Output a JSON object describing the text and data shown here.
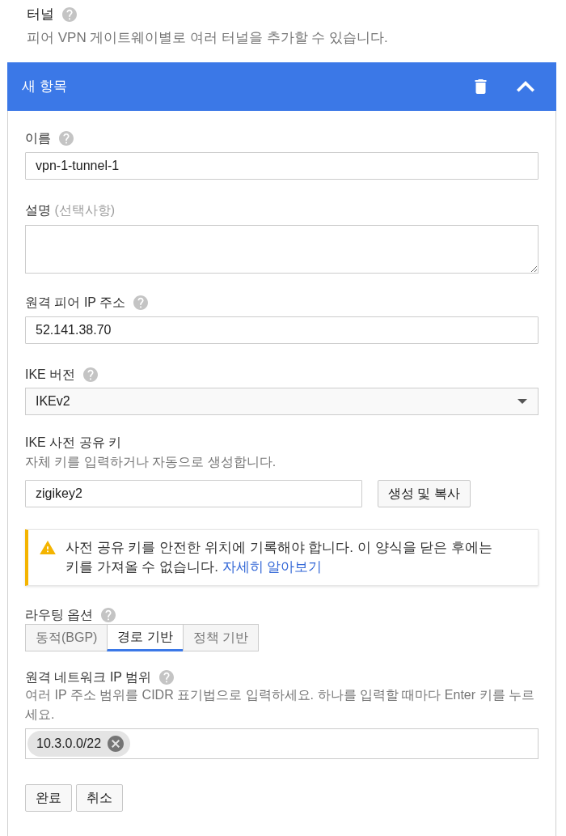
{
  "section": {
    "title": "터널",
    "help": true,
    "description": "피어 VPN 게이트웨이별로 여러 터널을 추가할 수 있습니다."
  },
  "panel": {
    "title": "새 항목",
    "expanded": true
  },
  "fields": [
    {
      "kind": "text",
      "label": "이름",
      "help": true,
      "value": "vpn-1-tunnel-1"
    },
    {
      "kind": "textarea",
      "label": "설명",
      "note": "(선택사항)",
      "help": false
    },
    {
      "kind": "text",
      "label": "원격 피어 IP 주소",
      "help": true,
      "value": "52.141.38.70"
    },
    {
      "kind": "select",
      "label": "IKE 버전",
      "help": true,
      "value": "IKEv2"
    },
    {
      "kind": "key",
      "label": "IKE 사전 공유 키",
      "help": false,
      "hint": "자체 키를 입력하거나 자동으로 생성합니다.",
      "value": "zigikey2",
      "button": "생성 및 복사"
    },
    {
      "kind": "warning",
      "text": "사전 공유 키를 안전한 위치에 기록해야 합니다. 이 양식을 닫은 후에는 키를 가져올 수 없습니다.",
      "link": "자세히 알아보기"
    },
    {
      "kind": "tabs",
      "label": "라우팅 옵션",
      "help": true,
      "options": [
        {
          "label": "동적(BGP)",
          "selected": false
        },
        {
          "label": "경로 기반",
          "selected": true
        },
        {
          "label": "정책 기반",
          "selected": false
        }
      ]
    },
    {
      "kind": "chips",
      "label": "원격 네트워크 IP 범위",
      "help": true,
      "hint": "여러 IP 주소 범위를 CIDR 표기법으로 입력하세요. 하나를 입력할 때마다 Enter 키를 누르세요.",
      "chips": [
        "10.3.0.0/22"
      ]
    }
  ],
  "buttons": [
    "완료",
    "취소"
  ]
}
